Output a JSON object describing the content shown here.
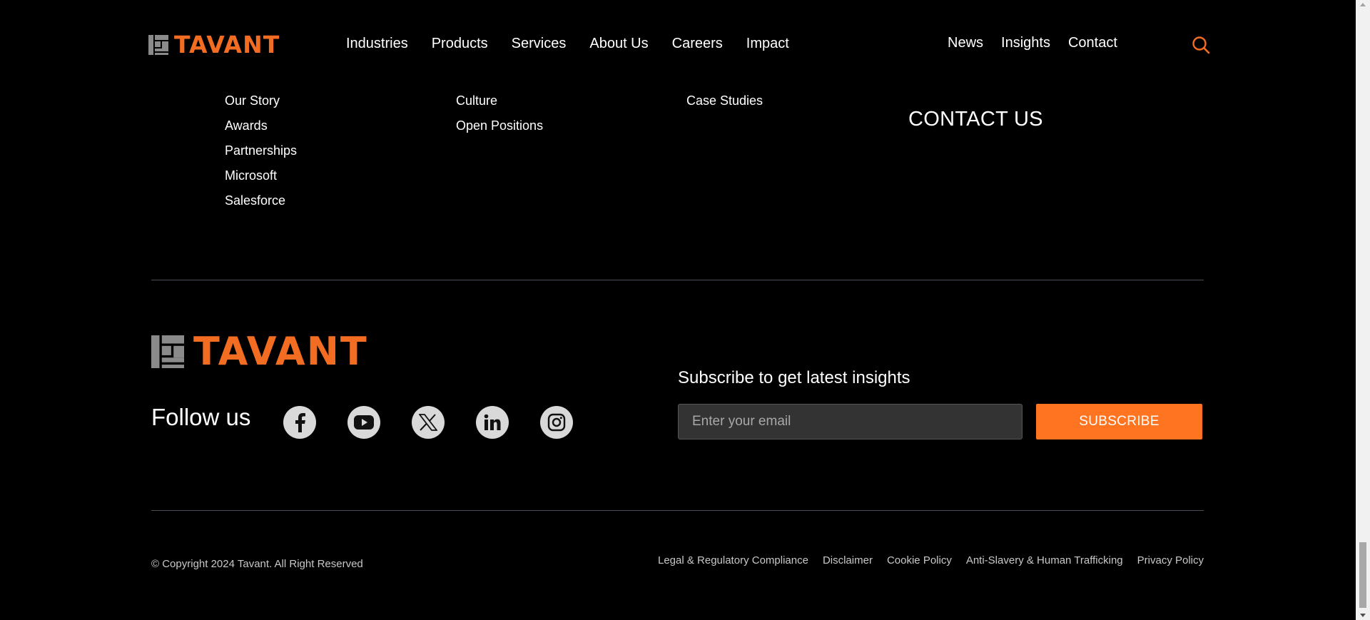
{
  "brand": {
    "name": "TAVANT",
    "accent": "#f26c21",
    "button_color": "#ff7421"
  },
  "header": {
    "main_nav": [
      {
        "label": "Industries"
      },
      {
        "label": "Products"
      },
      {
        "label": "Services"
      },
      {
        "label": "About Us"
      },
      {
        "label": "Careers"
      },
      {
        "label": "Impact"
      }
    ],
    "util_nav": [
      {
        "label": "News"
      },
      {
        "label": "Insights"
      },
      {
        "label": "Contact"
      }
    ],
    "search_icon": "search-icon"
  },
  "dropdown": {
    "about": [
      "Our Story",
      "Awards",
      "Partnerships",
      "Microsoft",
      "Salesforce"
    ],
    "careers": [
      "Culture",
      "Open Positions"
    ],
    "impact": [
      "Case Studies"
    ],
    "contact_heading": "CONTACT US"
  },
  "footer": {
    "follow_label": "Follow us",
    "socials": [
      {
        "icon": "facebook-icon"
      },
      {
        "icon": "youtube-icon"
      },
      {
        "icon": "x-twitter-icon"
      },
      {
        "icon": "linkedin-icon"
      },
      {
        "icon": "instagram-icon"
      }
    ],
    "subscribe": {
      "title": "Subscribe to get latest insights",
      "placeholder": "Enter your email",
      "value": "",
      "button_label": "SUBSCRIBE"
    },
    "copyright": "© Copyright 2024 Tavant. All Right Reserved",
    "legal_links": [
      "Legal & Regulatory Compliance",
      "Disclaimer",
      "Cookie Policy",
      "Anti-Slavery & Human Trafficking",
      "Privacy Policy"
    ]
  }
}
